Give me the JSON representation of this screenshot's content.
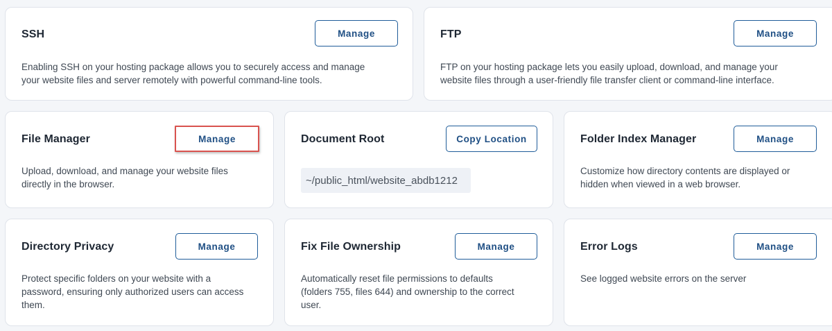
{
  "cards": {
    "ssh": {
      "title": "SSH",
      "button": "Manage",
      "desc_line1": "Enabling SSH on your hosting package allows you to securely access and manage",
      "desc_line2": "your website files and server remotely with powerful command-line tools."
    },
    "ftp": {
      "title": "FTP",
      "button": "Manage",
      "desc_line1": "FTP on your hosting package lets you easily upload, download, and manage your",
      "desc_line2": "website files through a user-friendly file transfer client or command-line interface."
    },
    "file_manager": {
      "title": "File Manager",
      "button": "Manage",
      "desc_line1": "Upload, download, and manage your website files",
      "desc_line2": "directly in the browser."
    },
    "document_root": {
      "title": "Document Root",
      "button": "Copy Location",
      "path": "~/public_html/website_abdb1212"
    },
    "folder_index": {
      "title": "Folder Index Manager",
      "button": "Manage",
      "desc_line1": "Customize how directory contents are displayed or",
      "desc_line2": "hidden when viewed in a web browser."
    },
    "directory_privacy": {
      "title": "Directory Privacy",
      "button": "Manage",
      "desc_line1": "Protect specific folders on your website with a",
      "desc_line2": "password, ensuring only authorized users can access",
      "desc_line3": "them."
    },
    "fix_ownership": {
      "title": "Fix File Ownership",
      "button": "Manage",
      "desc_line1": "Automatically reset file permissions to defaults",
      "desc_line2": "(folders 755, files 644) and ownership to the correct",
      "desc_line3": "user."
    },
    "error_logs": {
      "title": "Error Logs",
      "button": "Manage",
      "desc_line1": "See logged website errors on the server"
    }
  },
  "colors": {
    "accent": "#1f5c99",
    "highlight": "#d9534f",
    "background": "#f4f6f9"
  }
}
